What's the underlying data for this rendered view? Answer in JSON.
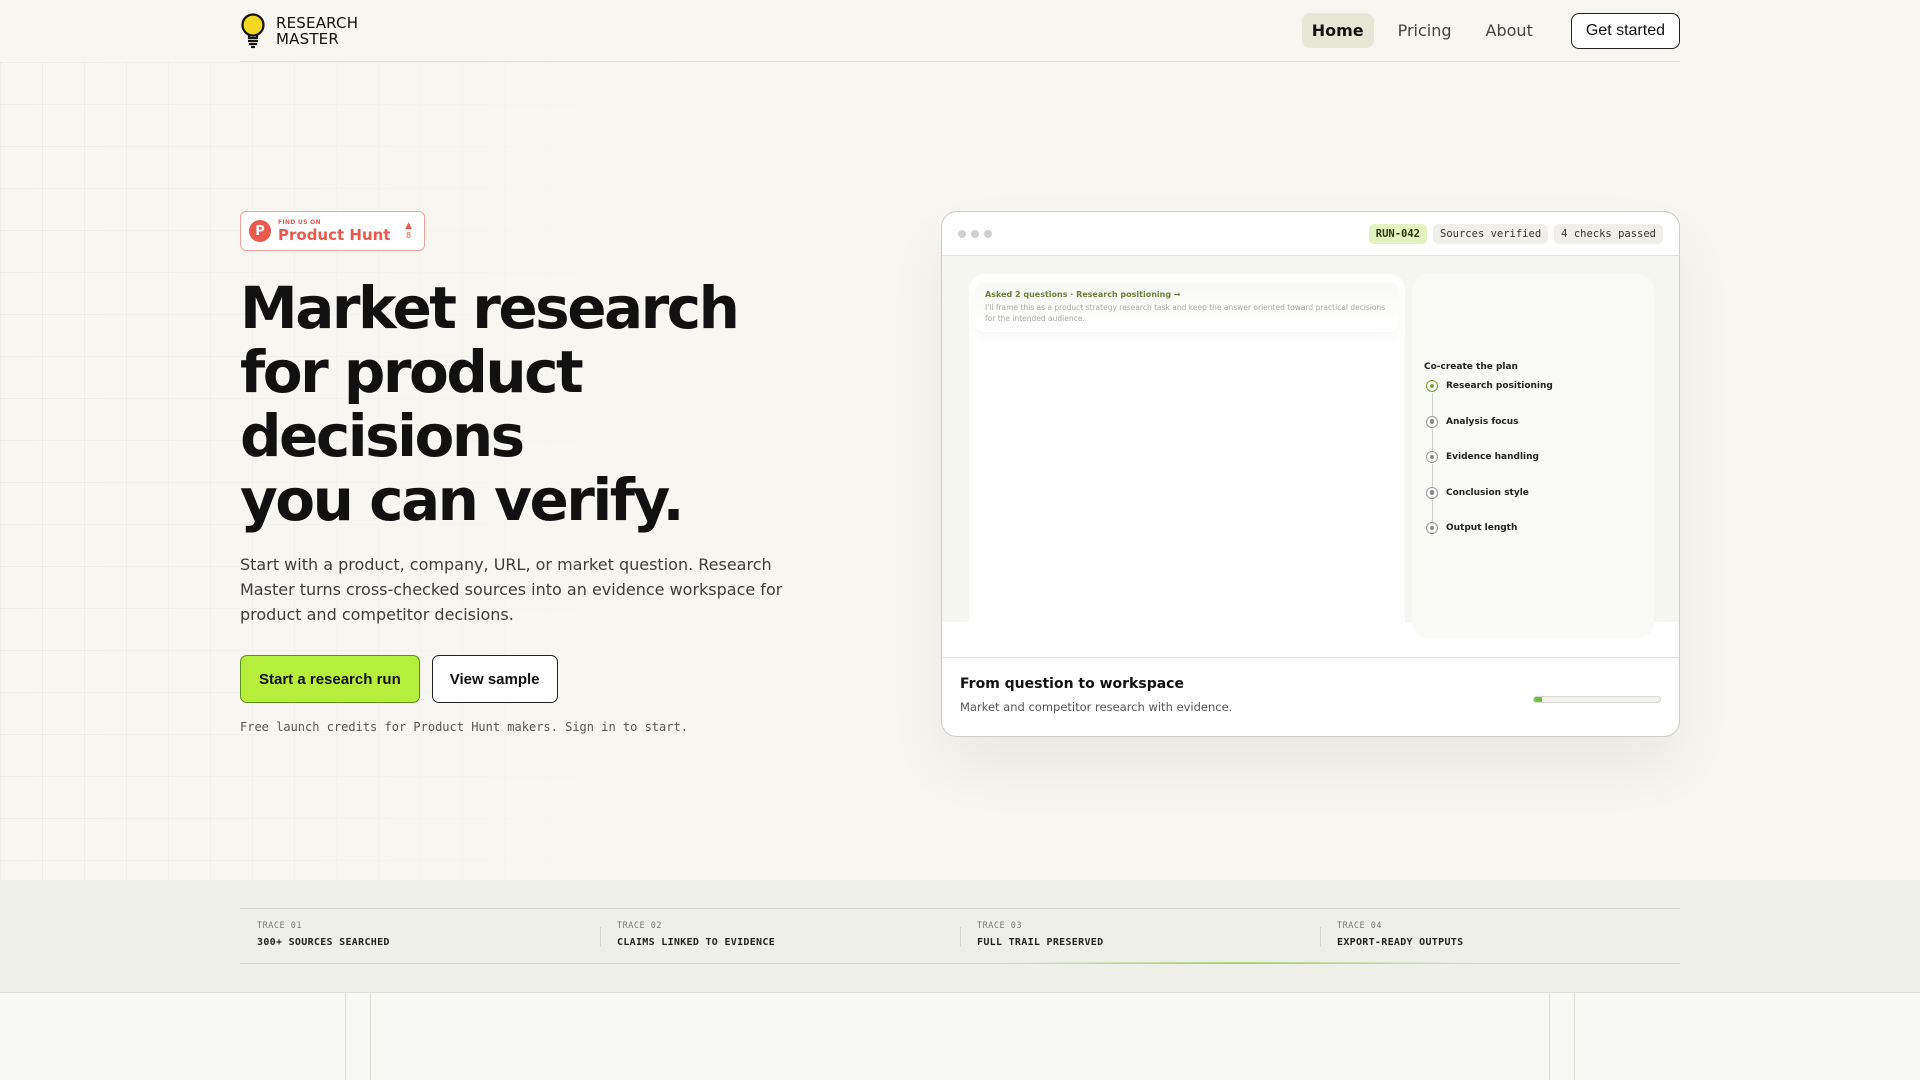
{
  "brand": {
    "line1": "RESEARCH",
    "line2": "MASTER"
  },
  "nav": {
    "items": [
      {
        "label": "Home",
        "active": true
      },
      {
        "label": "Pricing",
        "active": false
      },
      {
        "label": "About",
        "active": false
      }
    ],
    "cta": "Get started"
  },
  "product_hunt": {
    "small": "FIND US ON",
    "big": "Product Hunt",
    "letter": "P",
    "votes": "8"
  },
  "hero": {
    "title_lines": [
      "Market research",
      "for product",
      "decisions",
      "you can verify."
    ],
    "description": "Start with a product, company, URL, or market question. Research Master turns cross-checked sources into an evidence workspace for product and competitor decisions.",
    "primary_cta": "Start a research run",
    "secondary_cta": "View sample",
    "note": "Free launch credits for Product Hunt makers. Sign in to start."
  },
  "preview": {
    "tags": {
      "run": "RUN-042",
      "sources": "Sources verified",
      "checks": "4 checks passed"
    },
    "chat": {
      "title": "Asked 2 questions · Research positioning →",
      "text": "I'll frame this as a product strategy research task and keep the answer oriented toward practical decisions for the intended audience."
    },
    "plan": {
      "title": "Co-create the plan",
      "items": [
        "Research positioning",
        "Analysis focus",
        "Evidence handling",
        "Conclusion style",
        "Output length"
      ]
    },
    "footer": {
      "title": "From question to workspace",
      "subtitle": "Market and competitor research with evidence.",
      "progress": 0.06
    }
  },
  "traces": [
    {
      "num": "TRACE 01",
      "label": "300+ SOURCES SEARCHED"
    },
    {
      "num": "TRACE 02",
      "label": "CLAIMS LINKED TO EVIDENCE"
    },
    {
      "num": "TRACE 03",
      "label": "FULL TRAIL PRESERVED"
    },
    {
      "num": "TRACE 04",
      "label": "EXPORT-READY OUTPUTS"
    }
  ],
  "colors": {
    "accent": "#b6ee3e",
    "product_hunt": "#ea5a4c",
    "background": "#f7f6f1"
  }
}
